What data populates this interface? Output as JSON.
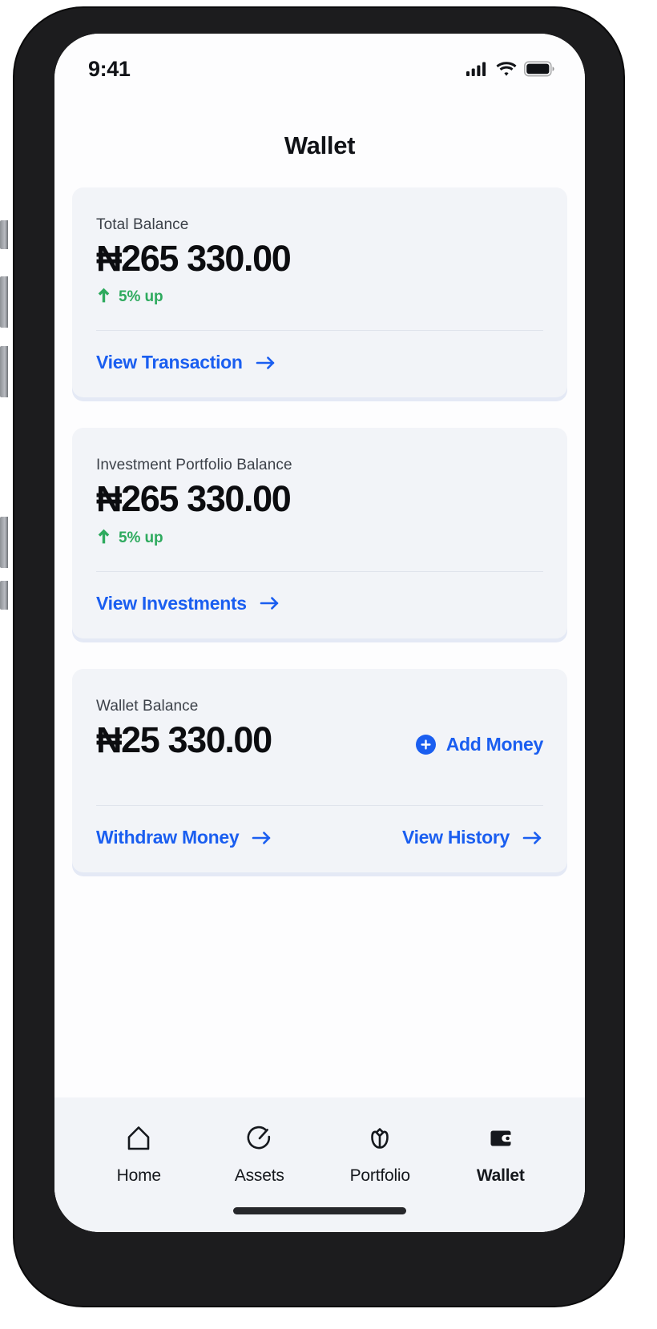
{
  "statusbar": {
    "time": "9:41",
    "signal_icon": "cellular-signal-icon",
    "wifi_icon": "wifi-icon",
    "battery_icon": "battery-icon"
  },
  "header": {
    "title": "Wallet"
  },
  "colors": {
    "accent_blue": "#1a5ef0",
    "trend_green": "#2eaa5e",
    "card_bg": "#f2f4f8",
    "card_shadow": "#e4e9f5",
    "text_dark": "#0c0d10"
  },
  "cards": [
    {
      "label": "Total Balance",
      "amount": "₦265 330.00",
      "trend": "5% up",
      "trend_icon": "arrow-up-icon",
      "link": "View Transaction",
      "link_icon": "arrow-right-icon"
    },
    {
      "label": "Investment Portfolio Balance",
      "amount": "₦265 330.00",
      "trend": "5% up",
      "trend_icon": "arrow-up-icon",
      "link": "View Investments",
      "link_icon": "arrow-right-icon"
    }
  ],
  "wallet_card": {
    "label": "Wallet Balance",
    "amount": "₦25 330.00",
    "add_money": "Add Money",
    "add_money_icon": "plus-circle-icon",
    "withdraw": "Withdraw Money",
    "withdraw_icon": "arrow-right-icon",
    "history": "View History",
    "history_icon": "arrow-right-icon"
  },
  "tabbar": {
    "items": [
      {
        "label": "Home",
        "icon": "home-icon",
        "active": false
      },
      {
        "label": "Assets",
        "icon": "gauge-icon",
        "active": false
      },
      {
        "label": "Portfolio",
        "icon": "tulip-icon",
        "active": false
      },
      {
        "label": "Wallet",
        "icon": "wallet-icon",
        "active": true
      }
    ]
  }
}
